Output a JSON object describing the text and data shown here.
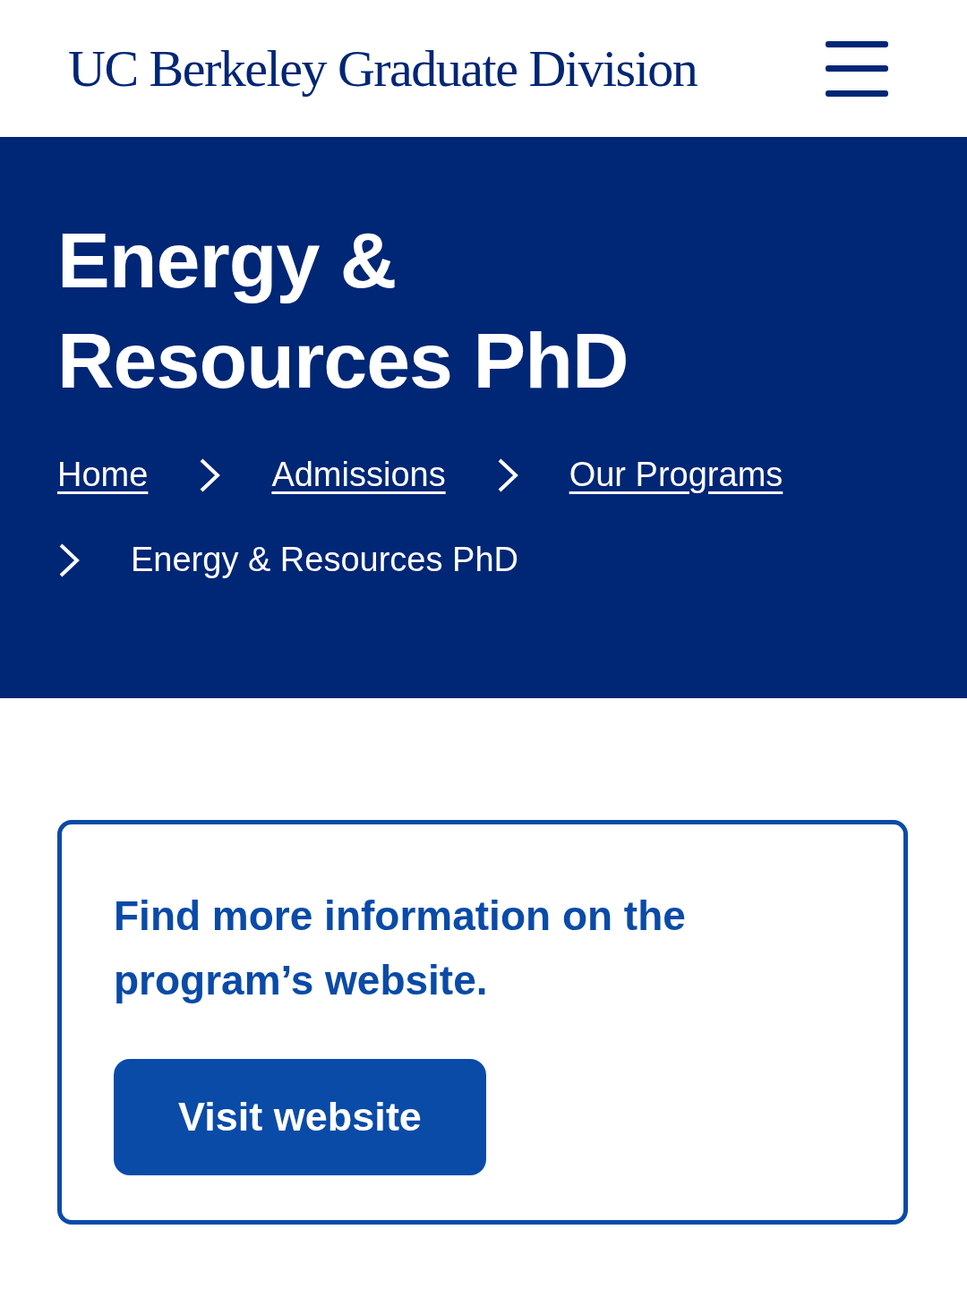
{
  "header": {
    "logo": "UC Berkeley Graduate Division"
  },
  "hero": {
    "title": "Energy & Resources PhD",
    "breadcrumbs": [
      {
        "label": "Home",
        "kind": "link"
      },
      {
        "label": "Admissions",
        "kind": "link"
      },
      {
        "label": "Our Programs",
        "kind": "link"
      },
      {
        "label": "Energy & Resources PhD",
        "kind": "current"
      }
    ]
  },
  "card": {
    "text": "Find more information on the program’s website.",
    "button": "Visit website"
  }
}
